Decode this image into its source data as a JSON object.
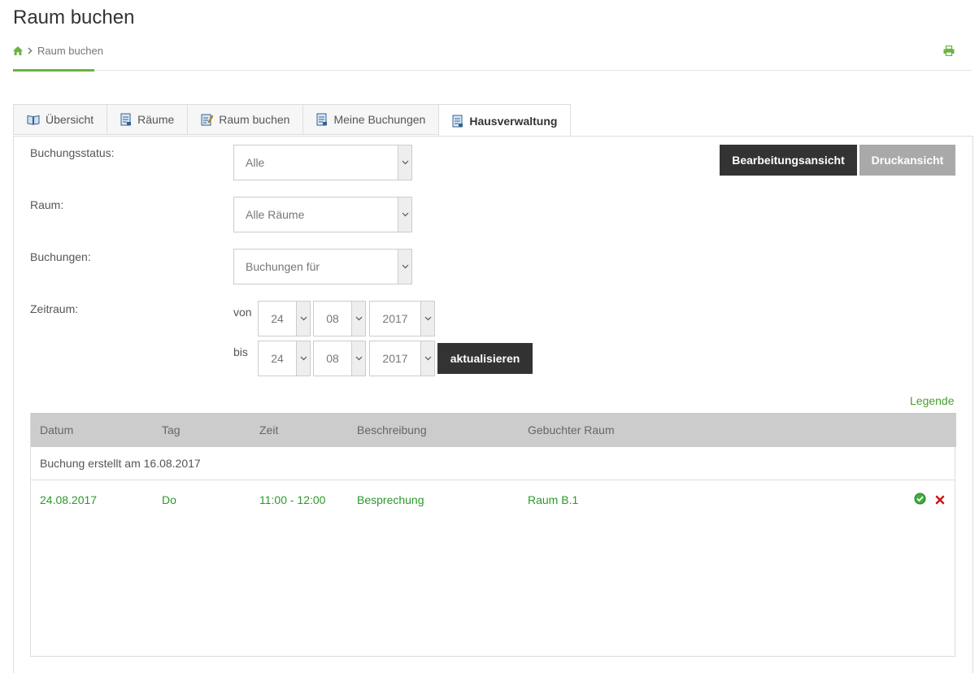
{
  "page": {
    "title": "Raum buchen"
  },
  "breadcrumb": {
    "current": "Raum buchen"
  },
  "tabs": [
    {
      "label": "Übersicht",
      "icon": "book-icon"
    },
    {
      "label": "Räume",
      "icon": "document-icon"
    },
    {
      "label": "Raum buchen",
      "icon": "edit-icon"
    },
    {
      "label": "Meine Buchungen",
      "icon": "document-icon"
    },
    {
      "label": "Hausverwaltung",
      "icon": "document-icon",
      "active": true
    }
  ],
  "filters": {
    "status_label": "Buchungsstatus:",
    "status_value": "Alle",
    "room_label": "Raum:",
    "room_value": "Alle Räume",
    "bookings_label": "Buchungen:",
    "bookings_value": "Buchungen für",
    "period_label": "Zeitraum:",
    "from_label": "von",
    "to_label": "bis",
    "from": {
      "day": "24",
      "month": "08",
      "year": "2017"
    },
    "to": {
      "day": "24",
      "month": "08",
      "year": "2017"
    },
    "update_label": "aktualisieren"
  },
  "buttons": {
    "edit_view": "Bearbeitungsansicht",
    "print_view": "Druckansicht"
  },
  "legend_label": "Legende",
  "table": {
    "headers": [
      "Datum",
      "Tag",
      "Zeit",
      "Beschreibung",
      "Gebuchter Raum"
    ],
    "group_label": "Buchung erstellt am 16.08.2017",
    "rows": [
      {
        "date": "24.08.2017",
        "day": "Do",
        "time": "11:00 - 12:00",
        "description": "Besprechung",
        "room": "Raum B.1"
      }
    ]
  },
  "colors": {
    "accent": "#6db33f",
    "link": "#4a9e2b",
    "row_text": "#2a9a2a",
    "dark_button": "#333333"
  }
}
